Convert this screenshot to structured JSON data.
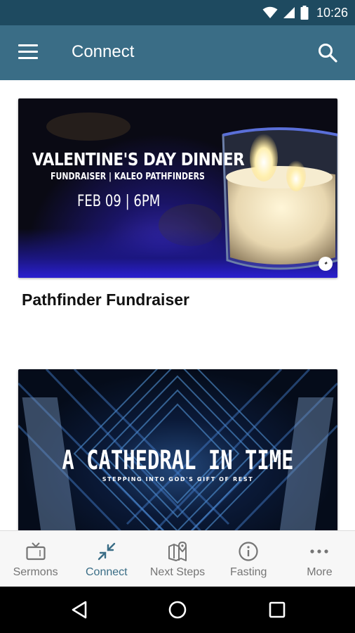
{
  "status_bar": {
    "time": "10:26"
  },
  "app_bar": {
    "title": "Connect"
  },
  "cards": [
    {
      "image_title": "VALENTINE'S DAY DINNER",
      "image_subtitle": "FUNDRAISER | KALEO PATHFINDERS",
      "image_date": "FEB 09 | 6PM",
      "title": "Pathfinder Fundraiser"
    },
    {
      "image_title": "A CATHEDRAL IN TIME",
      "image_subtitle": "STEPPING INTO GOD'S GIFT OF REST"
    }
  ],
  "bottom_nav": [
    {
      "label": "Sermons",
      "icon": "tv-icon"
    },
    {
      "label": "Connect",
      "icon": "connect-arrows-icon",
      "active": true
    },
    {
      "label": "Next Steps",
      "icon": "map-pin-icon"
    },
    {
      "label": "Fasting",
      "icon": "info-icon"
    },
    {
      "label": "More",
      "icon": "more-dots-icon"
    }
  ],
  "colors": {
    "app_bar": "#3a6d86",
    "status_bar": "#1e4a60",
    "active_nav": "#3a6d86",
    "inactive_nav": "#757575"
  }
}
